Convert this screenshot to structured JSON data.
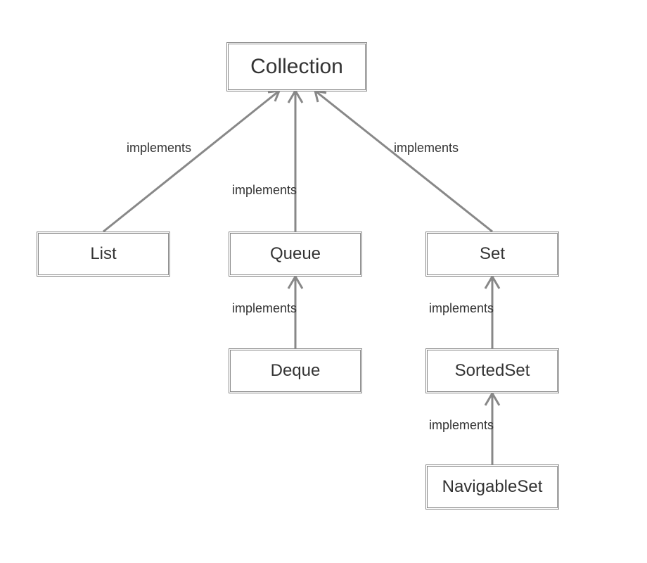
{
  "nodes": {
    "collection": {
      "label": "Collection"
    },
    "list": {
      "label": "List"
    },
    "queue": {
      "label": "Queue"
    },
    "set": {
      "label": "Set"
    },
    "deque": {
      "label": "Deque"
    },
    "sortedset": {
      "label": "SortedSet"
    },
    "navigableset": {
      "label": "NavigableSet"
    }
  },
  "edgeLabel": "implements",
  "edges": [
    {
      "from": "list",
      "to": "collection"
    },
    {
      "from": "queue",
      "to": "collection"
    },
    {
      "from": "set",
      "to": "collection"
    },
    {
      "from": "deque",
      "to": "queue"
    },
    {
      "from": "sortedset",
      "to": "set"
    },
    {
      "from": "navigableset",
      "to": "sortedset"
    }
  ]
}
